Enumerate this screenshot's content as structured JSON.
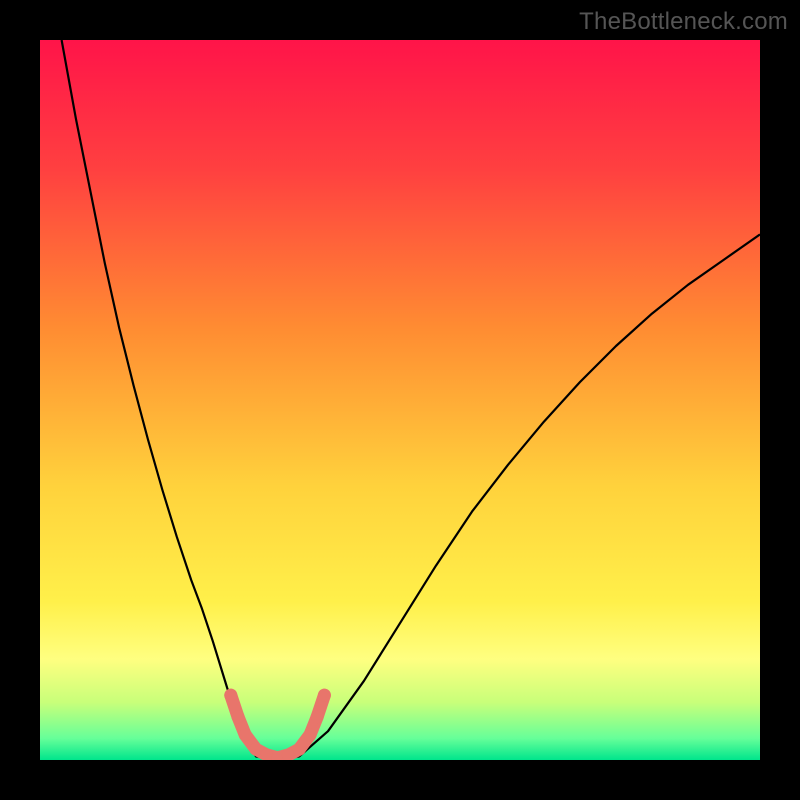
{
  "watermark": "TheBottleneck.com",
  "chart_data": {
    "type": "line",
    "title": "",
    "xlabel": "",
    "ylabel": "",
    "xlim": [
      0,
      100
    ],
    "ylim": [
      0,
      100
    ],
    "gradient_stops": [
      {
        "offset": 0,
        "color": "#ff1449"
      },
      {
        "offset": 0.18,
        "color": "#ff4040"
      },
      {
        "offset": 0.4,
        "color": "#ff8c32"
      },
      {
        "offset": 0.62,
        "color": "#ffd23c"
      },
      {
        "offset": 0.78,
        "color": "#fff04a"
      },
      {
        "offset": 0.86,
        "color": "#ffff80"
      },
      {
        "offset": 0.92,
        "color": "#c8ff7a"
      },
      {
        "offset": 0.97,
        "color": "#66ff99"
      },
      {
        "offset": 1.0,
        "color": "#00e58c"
      }
    ],
    "series": [
      {
        "name": "curve",
        "color": "#000000",
        "width": 2.2,
        "x": [
          3,
          5,
          7,
          9,
          11,
          13,
          15,
          17,
          19,
          21,
          22.5,
          24,
          26,
          28,
          30,
          33,
          36,
          40,
          45,
          50,
          55,
          60,
          65,
          70,
          75,
          80,
          85,
          90,
          95,
          100
        ],
        "y": [
          100,
          89,
          79,
          69,
          60,
          52,
          44.5,
          37.5,
          31,
          25,
          21,
          16.5,
          10,
          4,
          0.5,
          0,
          0.5,
          4,
          11,
          19,
          27,
          34.5,
          41,
          47,
          52.5,
          57.5,
          62,
          66,
          69.5,
          73
        ]
      },
      {
        "name": "valley-highlight",
        "color": "#e8756b",
        "width": 13,
        "linecap": "round",
        "x": [
          26.5,
          27.5,
          28.5,
          30,
          31.5,
          33,
          34.5,
          36,
          37.5,
          38.5,
          39.5
        ],
        "y": [
          9,
          6,
          3.5,
          1.5,
          0.7,
          0.3,
          0.7,
          1.5,
          3.5,
          6,
          9
        ]
      }
    ]
  }
}
